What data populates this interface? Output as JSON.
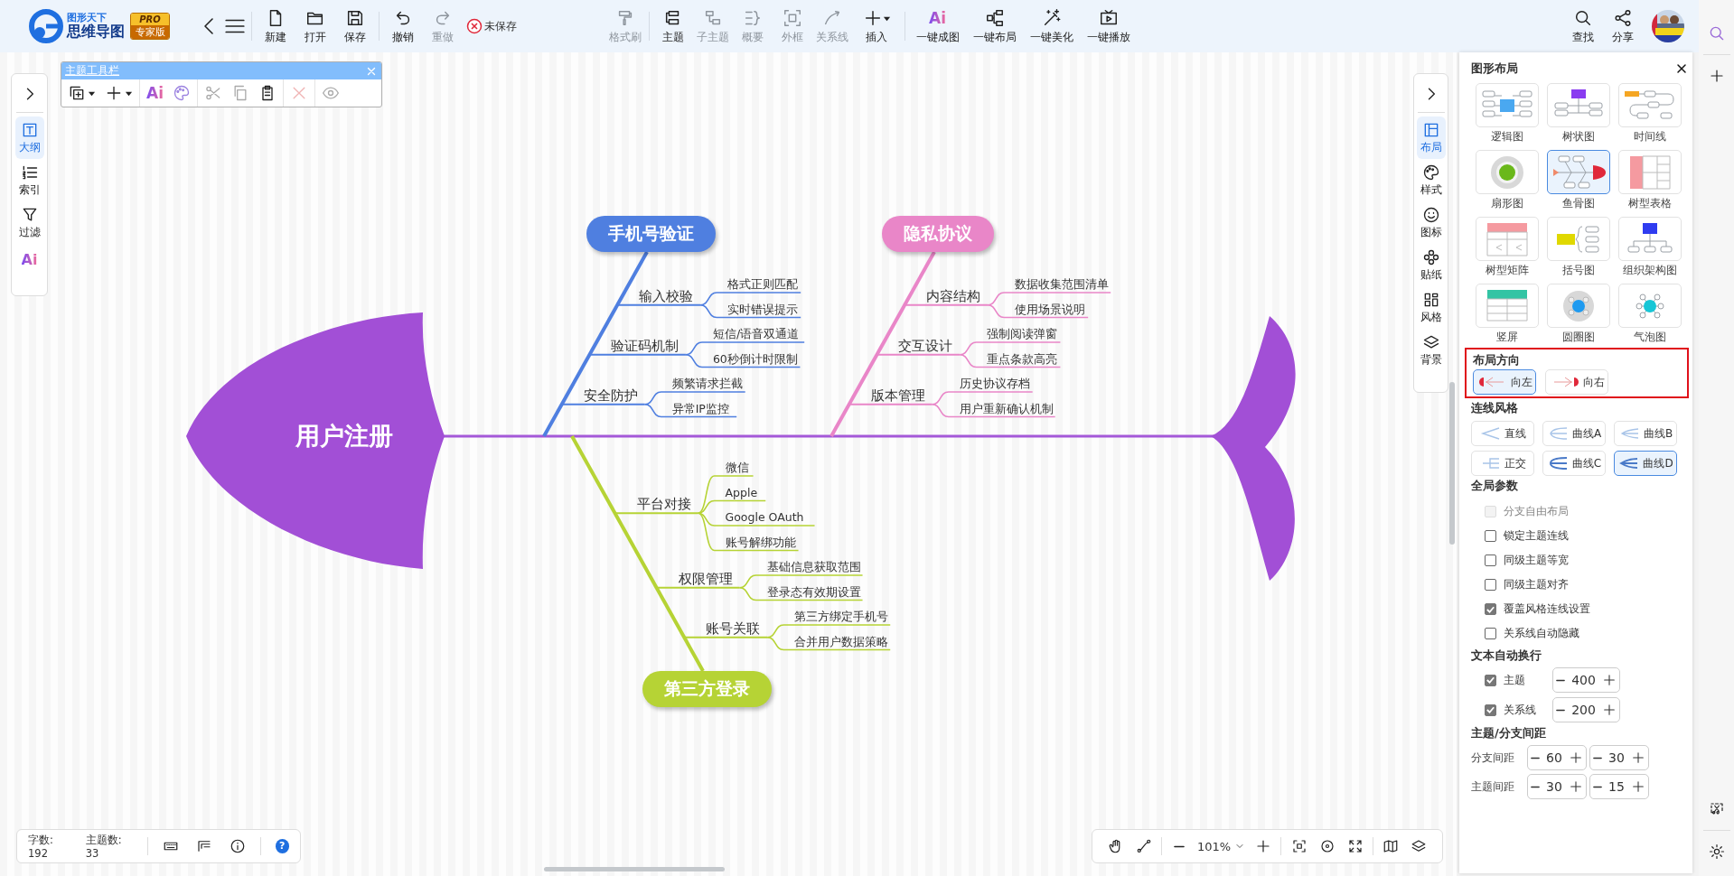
{
  "app": {
    "brand_tagline": "图形天下",
    "brand_name": "思维导图",
    "edition_top": "PRO",
    "edition_bottom": "专家版"
  },
  "toolbar": {
    "file": [
      {
        "label": "新建",
        "disabled": false
      },
      {
        "label": "打开",
        "disabled": false
      },
      {
        "label": "保存",
        "disabled": false
      }
    ],
    "history": [
      {
        "label": "撤销",
        "disabled": false
      },
      {
        "label": "重做",
        "disabled": true
      }
    ],
    "save_status": "未保存",
    "format": [
      {
        "label": "格式刷",
        "disabled": true
      }
    ],
    "topics": [
      {
        "label": "主题",
        "disabled": false
      },
      {
        "label": "子主题",
        "disabled": true
      },
      {
        "label": "概要",
        "disabled": true
      },
      {
        "label": "外框",
        "disabled": true
      },
      {
        "label": "关系线",
        "disabled": true
      },
      {
        "label": "插入",
        "disabled": false
      }
    ],
    "magic": [
      {
        "label": "一键成图",
        "icon_text": "Ai",
        "disabled": false
      },
      {
        "label": "一键布局",
        "disabled": false
      },
      {
        "label": "一键美化",
        "disabled": false
      },
      {
        "label": "一键播放",
        "disabled": false
      }
    ],
    "right": [
      {
        "label": "查找",
        "disabled": false
      },
      {
        "label": "分享",
        "disabled": false
      }
    ]
  },
  "left_sidebar": {
    "items": [
      {
        "label": "大纲",
        "selected": true
      },
      {
        "label": "索引",
        "selected": false
      },
      {
        "label": "过滤",
        "selected": false
      }
    ],
    "ai": "Ai"
  },
  "topic_toolbar": {
    "title": "主题工具栏",
    "groups": [
      [
        {
          "disabled": false
        },
        {
          "disabled": false
        }
      ],
      [
        {
          "text": "Ai",
          "disabled": false
        },
        {
          "disabled": false
        }
      ],
      [
        {
          "disabled": true
        },
        {
          "disabled": true
        },
        {
          "disabled": false
        }
      ],
      [
        {
          "disabled": true
        }
      ],
      [
        {
          "disabled": true
        }
      ]
    ]
  },
  "mindmap": {
    "root": "用户注册",
    "branches": [
      {
        "title": "手机号验证",
        "kind": "up",
        "color": "#4f7fe0",
        "children": [
          {
            "label": "输入校验",
            "children": [
              {
                "label": "格式正则匹配"
              },
              {
                "label": "实时错误提示"
              }
            ]
          },
          {
            "label": "验证码机制",
            "children": [
              {
                "label": "短信/语音双通道"
              },
              {
                "label": "60秒倒计时限制"
              }
            ]
          },
          {
            "label": "安全防护",
            "children": [
              {
                "label": "频繁请求拦截"
              },
              {
                "label": "异常IP监控"
              }
            ]
          }
        ]
      },
      {
        "title": "隐私协议",
        "kind": "up",
        "color": "#e986c8",
        "children": [
          {
            "label": "内容结构",
            "children": [
              {
                "label": "数据收集范围清单"
              },
              {
                "label": "使用场景说明"
              }
            ]
          },
          {
            "label": "交互设计",
            "children": [
              {
                "label": "强制阅读弹窗"
              },
              {
                "label": "重点条款高亮"
              }
            ]
          },
          {
            "label": "版本管理",
            "children": [
              {
                "label": "历史协议存档"
              },
              {
                "label": "用户重新确认机制"
              }
            ]
          }
        ]
      },
      {
        "title": "第三方登录",
        "kind": "down",
        "color": "#b6d335",
        "children": [
          {
            "label": "平台对接",
            "children": [
              {
                "label": "微信"
              },
              {
                "label": "Apple"
              },
              {
                "label": "Google OAuth"
              },
              {
                "label": "账号解绑功能"
              }
            ]
          },
          {
            "label": "权限管理",
            "children": [
              {
                "label": "基础信息获取范围"
              },
              {
                "label": "登录态有效期设置"
              }
            ]
          },
          {
            "label": "账号关联",
            "children": [
              {
                "label": "第三方绑定手机号"
              },
              {
                "label": "合并用户数据策略"
              }
            ]
          }
        ]
      }
    ]
  },
  "right_tabs": [
    {
      "label": "布局",
      "selected": true
    },
    {
      "label": "样式",
      "selected": false
    },
    {
      "label": "图标",
      "selected": false
    },
    {
      "label": "贴纸",
      "selected": false
    },
    {
      "label": "风格",
      "selected": false
    },
    {
      "label": "背景",
      "selected": false
    }
  ],
  "panel": {
    "title": "图形布局",
    "layouts": [
      {
        "label": "逻辑图",
        "kind": "logic",
        "selected": false
      },
      {
        "label": "树状图",
        "kind": "tree",
        "selected": false
      },
      {
        "label": "时间线",
        "kind": "timeline",
        "selected": false
      },
      {
        "label": "扇形图",
        "kind": "sector",
        "selected": false
      },
      {
        "label": "鱼骨图",
        "kind": "fishbone",
        "selected": true
      },
      {
        "label": "树型表格",
        "kind": "treetable",
        "selected": false
      },
      {
        "label": "树型矩阵",
        "kind": "matrix",
        "selected": false
      },
      {
        "label": "括号图",
        "kind": "bracket",
        "selected": false
      },
      {
        "label": "组织架构图",
        "kind": "org",
        "selected": false
      },
      {
        "label": "竖屏",
        "kind": "vertical",
        "selected": false
      },
      {
        "label": "圆圈图",
        "kind": "circle",
        "selected": false
      },
      {
        "label": "气泡图",
        "kind": "bubble",
        "selected": false
      }
    ],
    "direction": {
      "title": "布局方向",
      "highlighted": true,
      "options": [
        {
          "label": "向左",
          "kind": "left",
          "selected": true
        },
        {
          "label": "向右",
          "kind": "right",
          "selected": false
        }
      ]
    },
    "line_styles": {
      "title": "连线风格",
      "options": [
        {
          "label": "直线",
          "kind": "straight",
          "selected": false
        },
        {
          "label": "曲线A",
          "kind": "curve-a",
          "selected": false
        },
        {
          "label": "曲线B",
          "kind": "curve-b",
          "selected": false
        },
        {
          "label": "正交",
          "kind": "orthogonal",
          "selected": false
        },
        {
          "label": "曲线C",
          "kind": "curve-c",
          "selected": false
        },
        {
          "label": "曲线D",
          "kind": "curve-d",
          "selected": true
        }
      ]
    },
    "globals": {
      "title": "全局参数",
      "options": [
        {
          "label": "分支自由布局",
          "checked": false,
          "disabled": true
        },
        {
          "label": "锁定主题连线",
          "checked": false,
          "disabled": false
        },
        {
          "label": "同级主题等宽",
          "checked": false,
          "disabled": false
        },
        {
          "label": "同级主题对齐",
          "checked": false,
          "disabled": false
        },
        {
          "label": "覆盖风格连线设置",
          "checked": true,
          "disabled": false
        },
        {
          "label": "关系线自动隐藏",
          "checked": false,
          "disabled": false
        }
      ]
    },
    "wrap": {
      "title": "文本自动换行",
      "rows": [
        {
          "label": "主题",
          "checked": true,
          "value": "400"
        },
        {
          "label": "关系线",
          "checked": true,
          "value": "200"
        }
      ]
    },
    "spacing": {
      "title": "主题/分支间距",
      "rows": [
        {
          "label": "分支间距",
          "values": [
            "60",
            "30"
          ]
        },
        {
          "label": "主题间距",
          "values": [
            "30",
            "15"
          ]
        }
      ]
    }
  },
  "status_bar": {
    "word_count": "字数: 192",
    "topic_count": "主题数: 33",
    "help": "?"
  },
  "zoom_bar": {
    "zoom": "101%"
  }
}
